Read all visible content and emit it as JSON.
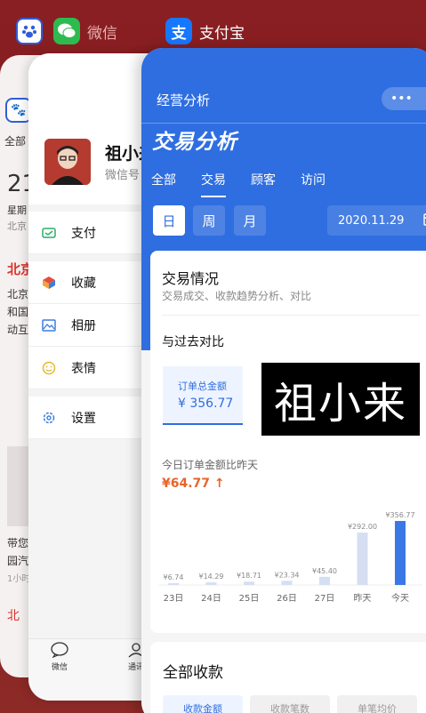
{
  "top_labels": {
    "wechat": "微信",
    "alipay": "支付宝"
  },
  "baidu": {
    "tab_all": "全部",
    "day_number": "21",
    "weekday": "星期",
    "city": "北京",
    "news_head": "北京",
    "lines": [
      "北京",
      "和国",
      "动互"
    ],
    "lines2": [
      "带您",
      "园汽",
      "1小时"
    ],
    "footer_short": "北"
  },
  "wechat": {
    "name": "祖小来",
    "id_prefix": "微信号",
    "menu": [
      {
        "label": "支付",
        "icon": "pay-icon",
        "color": "#2aae67"
      },
      {
        "label": "收藏",
        "icon": "collect-icon",
        "color": "#e8a43a"
      },
      {
        "label": "相册",
        "icon": "album-icon",
        "color": "#3d7de0"
      },
      {
        "label": "表情",
        "icon": "emoji-icon",
        "color": "#e8b730"
      },
      {
        "label": "设置",
        "icon": "settings-icon",
        "color": "#3d7de0"
      }
    ],
    "tab_wechat": "微信",
    "tab_contacts": "通讯"
  },
  "alipay": {
    "page_title": "经营分析",
    "big_title": "交易分析",
    "tabs": [
      "全部",
      "交易",
      "顾客",
      "访问"
    ],
    "active_tab_index": 1,
    "periods": [
      "日",
      "周",
      "月"
    ],
    "active_period_index": 0,
    "date": "2020.11.29",
    "section_title": "交易情况",
    "section_subtitle": "交易成交、收款趋势分析、对比",
    "compare_title": "与过去对比",
    "metric_label": "订单总金额",
    "metric_value": "¥ 356.77",
    "watermark": "祖小来",
    "today_compare": "今日订单金额比昨天",
    "today_delta": "¥64.77 ↑",
    "next_section": "全部收款",
    "next_chips": [
      "收款金额",
      "收款笔数",
      "单笔均价"
    ]
  },
  "chart_data": {
    "type": "bar",
    "categories": [
      "23日",
      "24日",
      "25日",
      "26日",
      "27日",
      "昨天",
      "今天"
    ],
    "values": [
      6.74,
      14.29,
      18.71,
      23.34,
      45.4,
      292.0,
      356.77
    ],
    "value_labels": [
      "¥6.74",
      "¥14.29",
      "¥18.71",
      "¥23.34",
      "¥45.40",
      "¥292.00",
      "¥356.77"
    ],
    "ylim": [
      0,
      356.77
    ],
    "highlight_index": 6,
    "colors": {
      "normal": "#d6def3",
      "highlight": "#3a78e6"
    }
  }
}
